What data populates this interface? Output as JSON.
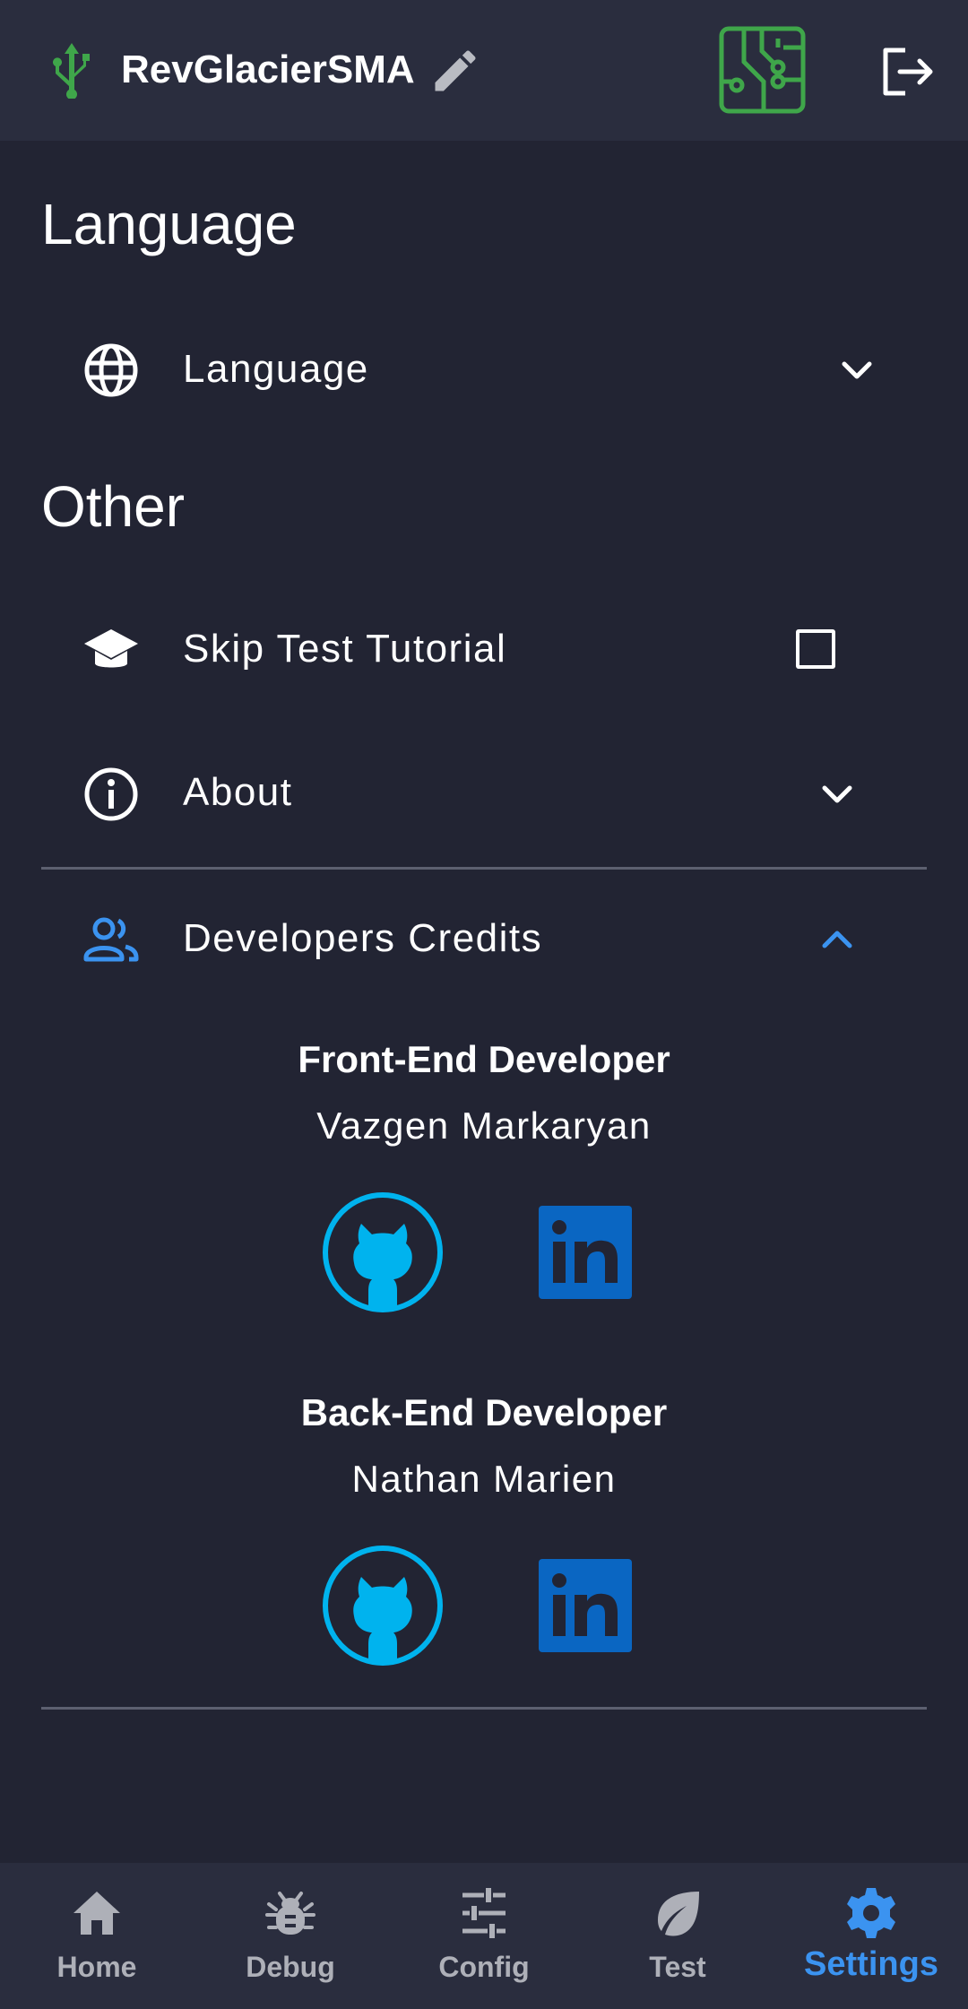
{
  "header": {
    "device_name": "RevGlacierSMA",
    "icons": [
      "usb-icon",
      "edit-icon",
      "circuit-board-icon",
      "logout-icon"
    ],
    "accent_color": "#3fa64a"
  },
  "sections": {
    "language_title": "Language",
    "other_title": "Other"
  },
  "rows": {
    "language": "Language",
    "skip_tutorial": "Skip Test Tutorial",
    "skip_tutorial_checked": false,
    "about": "About",
    "credits": "Developers Credits"
  },
  "credits": [
    {
      "role": "Front-End Developer",
      "name": "Vazgen Markaryan"
    },
    {
      "role": "Back-End Developer",
      "name": "Nathan Marien"
    }
  ],
  "tabs": [
    {
      "label": "Home",
      "icon": "home-icon",
      "active": false
    },
    {
      "label": "Debug",
      "icon": "bug-icon",
      "active": false
    },
    {
      "label": "Config",
      "icon": "sliders-icon",
      "active": false
    },
    {
      "label": "Test",
      "icon": "leaf-icon",
      "active": false
    },
    {
      "label": "Settings",
      "icon": "gear-icon",
      "active": true
    }
  ],
  "colors": {
    "background": "#222433",
    "bar": "#2a2d3e",
    "active_blue": "#3b93f0",
    "github_cyan": "#00b3ee",
    "linkedin_blue": "#0a66c2"
  }
}
